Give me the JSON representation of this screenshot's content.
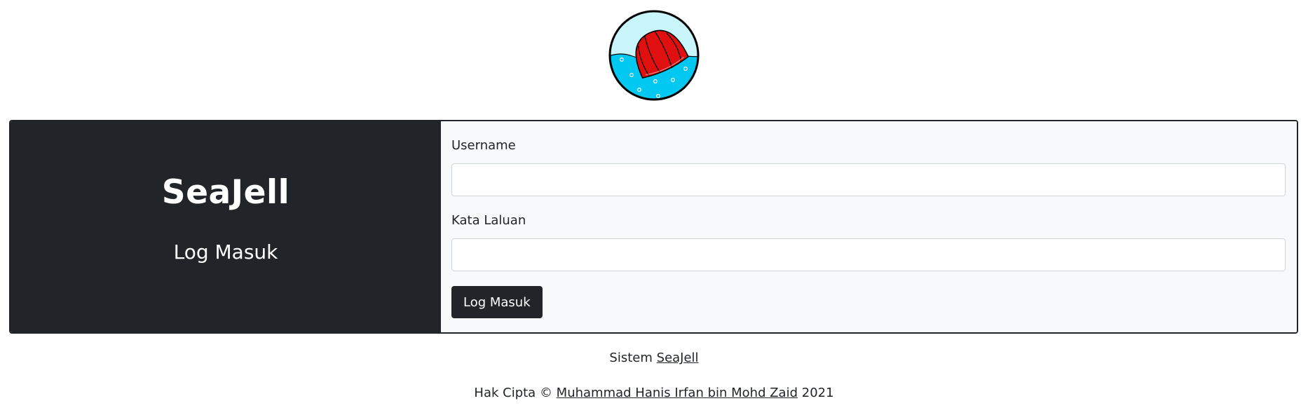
{
  "logo": {
    "icon": "jelly-logo-icon",
    "colors": {
      "sky": "#c8f6fb",
      "water": "#00c8f0",
      "jelly": "#e01010",
      "outline": "#000000"
    }
  },
  "brand": {
    "title": "SeaJell",
    "subtitle": "Log Masuk"
  },
  "form": {
    "username_label": "Username",
    "username_value": "",
    "password_label": "Kata Laluan",
    "password_value": "",
    "submit_label": "Log Masuk"
  },
  "footer": {
    "system_prefix": "Sistem",
    "system_link": "SeaJell",
    "copyright_prefix": "Hak Cipta ©",
    "author_link": "Muhammad Hanis Irfan bin Mohd Zaid",
    "year": "2021"
  },
  "colors": {
    "dark": "#212529",
    "light": "#f8f9fa"
  }
}
